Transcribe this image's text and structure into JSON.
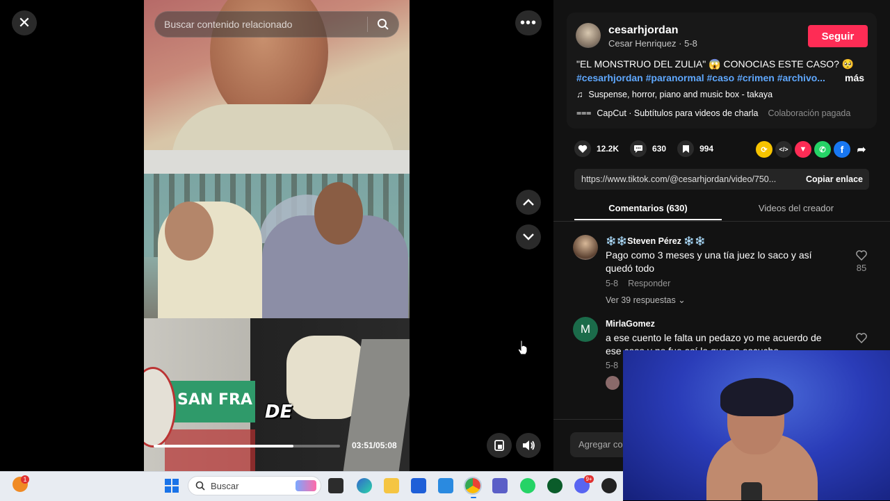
{
  "search": {
    "placeholder": "Buscar contenido relacionado"
  },
  "video": {
    "caption_word": "DE",
    "sign_text": "SAN FRA",
    "time": "03:51/05:08",
    "progress": 0.75
  },
  "author": {
    "username": "cesarhjordan",
    "subline": "Cesar Henriquez · 5-8",
    "follow_label": "Seguir"
  },
  "description": {
    "text": "\"EL MONSTRUO DEL ZULIA\" 😱 CONOCIAS ESTE CASO? 🥺",
    "hashtags": "#cesarhjordan #paranormal #caso #crimen #archivo...",
    "more": "más",
    "music": "Suspense, horror, piano and music box - takaya",
    "capcut": "CapCut · Subtítulos para videos de charla",
    "paid_tag": "Colaboración pagada"
  },
  "actions": {
    "likes": "12.2K",
    "comments": "630",
    "saves": "994"
  },
  "link": {
    "url": "https://www.tiktok.com/@cesarhjordan/video/750...",
    "copy_label": "Copiar enlace"
  },
  "tabs": {
    "comments": "Comentarios (630)",
    "videos": "Videos del creador"
  },
  "comments": [
    {
      "name": "❄️❄️Steven Pérez ❄️❄️",
      "text": "Pago como 3 meses y una tía juez lo saco y así quedó todo",
      "date": "5-8",
      "reply": "Responder",
      "replies": "Ver 39 respuestas",
      "likes": "85"
    },
    {
      "avatar_letter": "M",
      "name": "MirlaGomez",
      "text": "a ese cuento le falta un pedazo yo me acuerdo de ese caso y no fue así lo que se escucho",
      "date": "5-8"
    }
  ],
  "add_comment": {
    "placeholder": "Agregar co"
  },
  "taskbar": {
    "search_label": "Buscar",
    "badge": "1",
    "discord_badge": "9+"
  },
  "colors": {
    "accent": "#fe2c55",
    "hashtag": "#5fa8ff",
    "panel": "#121212"
  }
}
